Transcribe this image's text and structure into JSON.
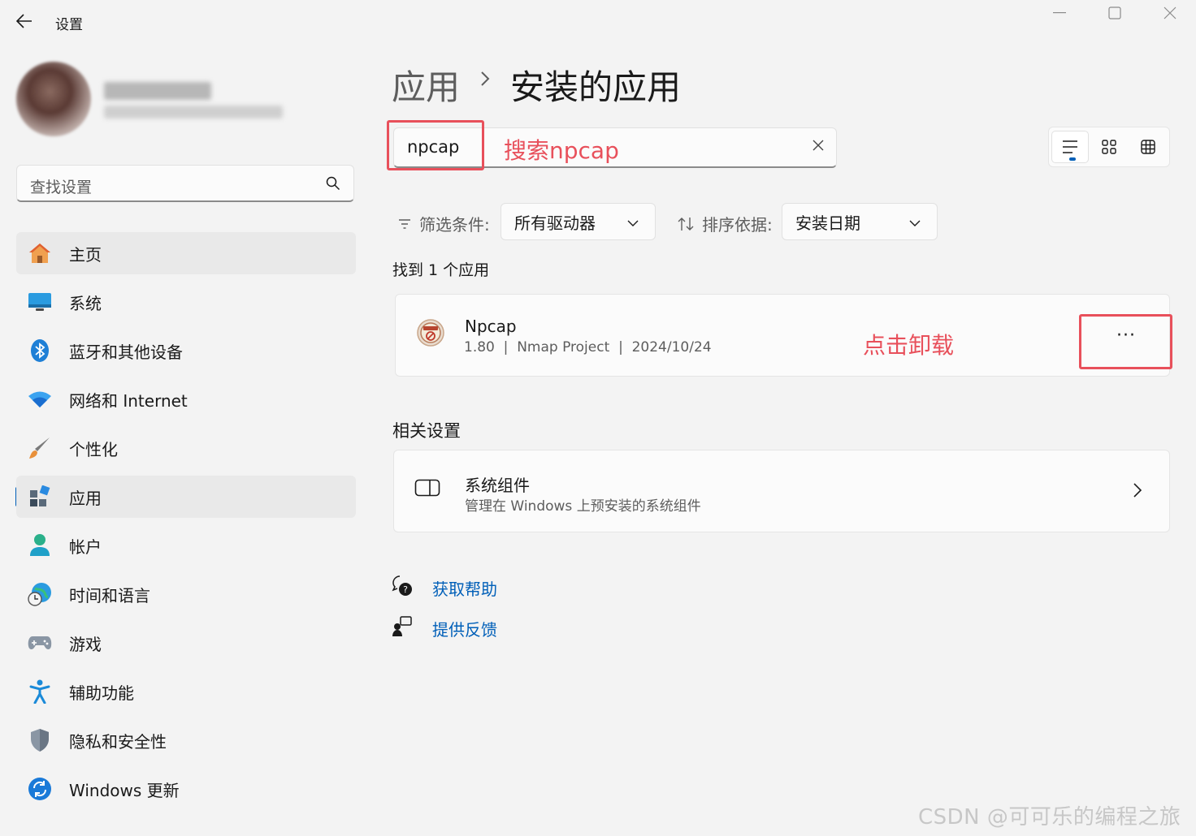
{
  "window": {
    "title": "设置",
    "back_icon": "arrow-left-icon",
    "controls": [
      "minimize-icon",
      "maximize-icon",
      "close-icon"
    ]
  },
  "sidebar": {
    "search_placeholder": "查找设置",
    "items": [
      {
        "label": "主页",
        "icon": "home-icon",
        "active": false,
        "highlight": true
      },
      {
        "label": "系统",
        "icon": "monitor-icon",
        "active": false
      },
      {
        "label": "蓝牙和其他设备",
        "icon": "bluetooth-icon",
        "active": false
      },
      {
        "label": "网络和 Internet",
        "icon": "wifi-icon",
        "active": false
      },
      {
        "label": "个性化",
        "icon": "brush-icon",
        "active": false
      },
      {
        "label": "应用",
        "icon": "apps-icon",
        "active": true
      },
      {
        "label": "帐户",
        "icon": "account-icon",
        "active": false
      },
      {
        "label": "时间和语言",
        "icon": "globe-clock-icon",
        "active": false
      },
      {
        "label": "游戏",
        "icon": "gamepad-icon",
        "active": false
      },
      {
        "label": "辅助功能",
        "icon": "accessibility-icon",
        "active": false
      },
      {
        "label": "隐私和安全性",
        "icon": "shield-icon",
        "active": false
      },
      {
        "label": "Windows 更新",
        "icon": "refresh-icon",
        "active": false
      }
    ]
  },
  "breadcrumb": {
    "parent": "应用",
    "current": "安装的应用"
  },
  "app_search": {
    "value": "npcap"
  },
  "annotations": {
    "search_note": "搜索npcap",
    "uninstall_note": "点击卸载",
    "color": "#e8505b"
  },
  "filter": {
    "label": "筛选条件:",
    "value": "所有驱动器"
  },
  "sort": {
    "label": "排序依据:",
    "value": "安装日期"
  },
  "results": {
    "count_text": "找到 1 个应用",
    "apps": [
      {
        "name": "Npcap",
        "version": "1.80",
        "publisher": "Nmap Project",
        "date": "2024/10/24",
        "more_label": "···"
      }
    ]
  },
  "related": {
    "title": "相关设置",
    "items": [
      {
        "title": "系统组件",
        "subtitle": "管理在 Windows 上预安装的系统组件"
      }
    ]
  },
  "help": {
    "get_help": "获取帮助",
    "feedback": "提供反馈"
  },
  "watermark": "CSDN @可可乐的编程之旅",
  "colors": {
    "accent": "#005fb8",
    "background": "#f3f3f3"
  }
}
